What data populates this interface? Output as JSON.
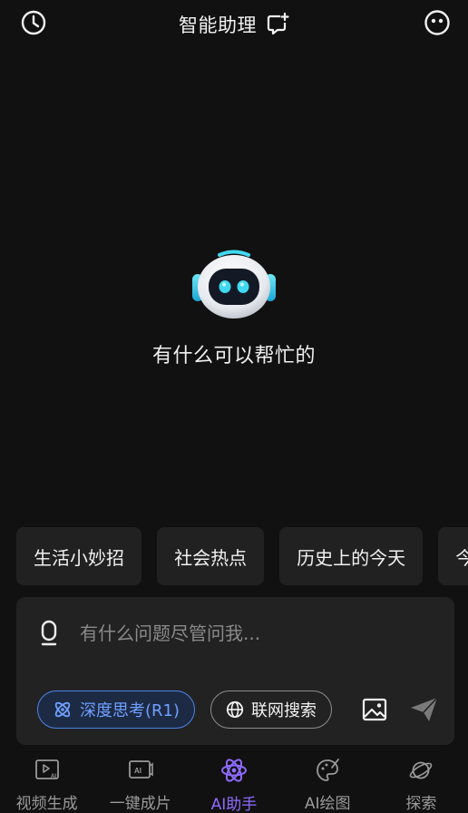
{
  "header": {
    "title": "智能助理",
    "history_icon": "clock-history-icon",
    "new_chat_icon": "new-chat-icon",
    "profile_icon": "robot-face-icon"
  },
  "hero": {
    "mascot": "robot-mascot",
    "greeting": "有什么可以帮忙的"
  },
  "suggestions": [
    "生活小妙招",
    "社会热点",
    "历史上的今天",
    "今日运势"
  ],
  "composer": {
    "placeholder": "有什么问题尽管问我...",
    "value": "",
    "deep_think_label": "深度思考(R1)",
    "web_search_label": "联网搜索",
    "deep_think_active": true
  },
  "tabs": [
    {
      "label": "视频生成",
      "icon": "video-generate-icon",
      "active": false
    },
    {
      "label": "一键成片",
      "icon": "ai-film-icon",
      "active": false
    },
    {
      "label": "AI助手",
      "icon": "atom-icon",
      "active": true
    },
    {
      "label": "AI绘图",
      "icon": "palette-icon",
      "active": false
    },
    {
      "label": "探索",
      "icon": "planet-icon",
      "active": false
    }
  ],
  "colors": {
    "background": "#111111",
    "accent_blue": "#4b83e8",
    "accent_purple": "#8f6bff",
    "mascot_eye": "#3fd8f0"
  }
}
